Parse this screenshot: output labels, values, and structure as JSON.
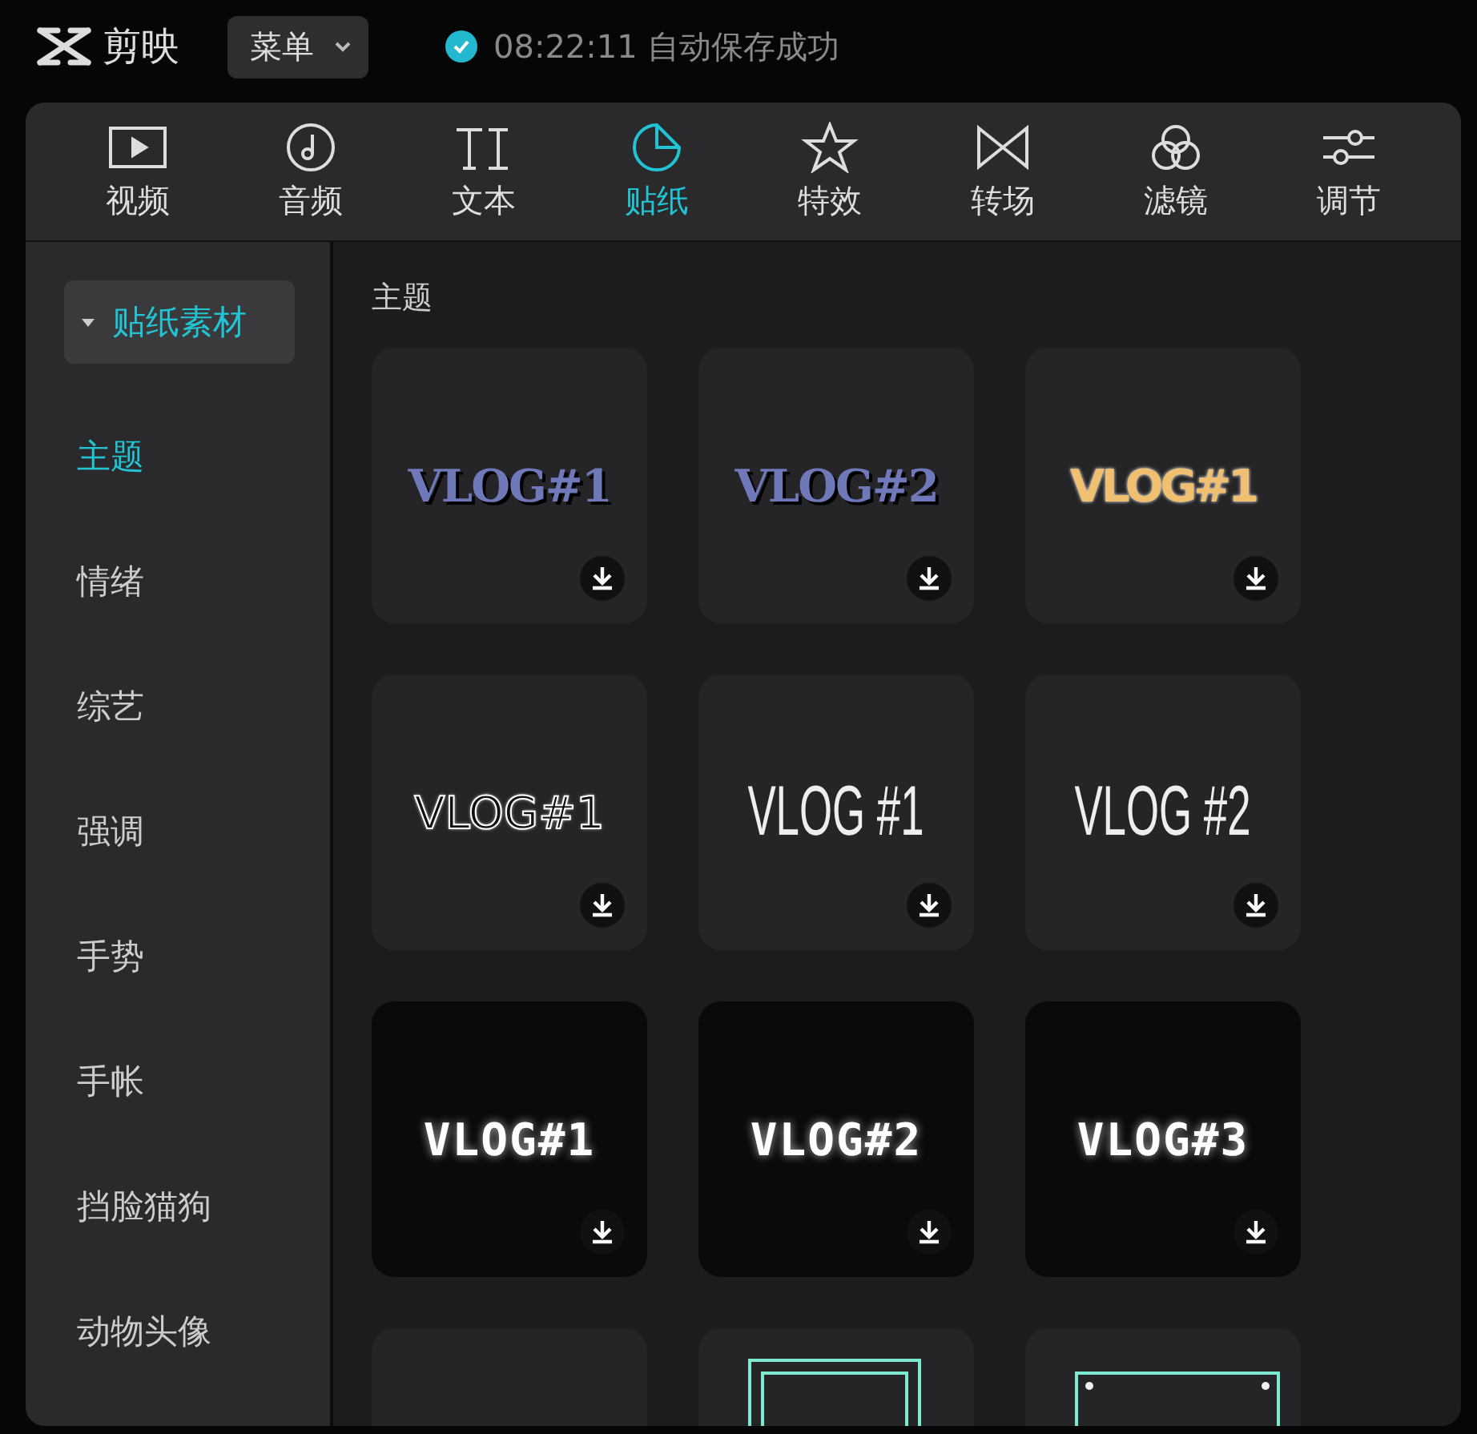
{
  "app": {
    "name": "剪映",
    "menu": "菜单",
    "save_status": "08:22:11 自动保存成功"
  },
  "tabs": [
    {
      "label": "视频",
      "kind": "video",
      "selected": false
    },
    {
      "label": "音频",
      "kind": "audio",
      "selected": false
    },
    {
      "label": "文本",
      "kind": "text",
      "selected": false
    },
    {
      "label": "贴纸",
      "kind": "sticker",
      "selected": true
    },
    {
      "label": "特效",
      "kind": "effect",
      "selected": false
    },
    {
      "label": "转场",
      "kind": "transition",
      "selected": false
    },
    {
      "label": "滤镜",
      "kind": "filter",
      "selected": false
    },
    {
      "label": "调节",
      "kind": "adjust",
      "selected": false
    }
  ],
  "sidebar": {
    "header": {
      "label": "贴纸素材",
      "expanded": true
    },
    "items": [
      {
        "label": "主题",
        "selected": true
      },
      {
        "label": "情绪",
        "selected": false
      },
      {
        "label": "综艺",
        "selected": false
      },
      {
        "label": "强调",
        "selected": false
      },
      {
        "label": "手势",
        "selected": false
      },
      {
        "label": "手帐",
        "selected": false
      },
      {
        "label": "挡脸猫狗",
        "selected": false
      },
      {
        "label": "动物头像",
        "selected": false
      }
    ]
  },
  "section_title": "主题",
  "stickers": [
    {
      "kind": "serif-blue",
      "text": "VLOG#1"
    },
    {
      "kind": "serif-blue",
      "text": "VLOG#2"
    },
    {
      "kind": "serif-gold",
      "text": "VLOG#1"
    },
    {
      "kind": "hand",
      "text": "VLOG#1"
    },
    {
      "kind": "thin",
      "text": "VLOG #1"
    },
    {
      "kind": "thin",
      "text": "VLOG #2"
    },
    {
      "kind": "pixel",
      "text": "VLOG#1"
    },
    {
      "kind": "pixel",
      "text": "VLOG#2"
    },
    {
      "kind": "pixel",
      "text": "VLOG#3"
    },
    {
      "kind": "blank"
    },
    {
      "kind": "neon-frame"
    },
    {
      "kind": "neon-dots"
    }
  ]
}
